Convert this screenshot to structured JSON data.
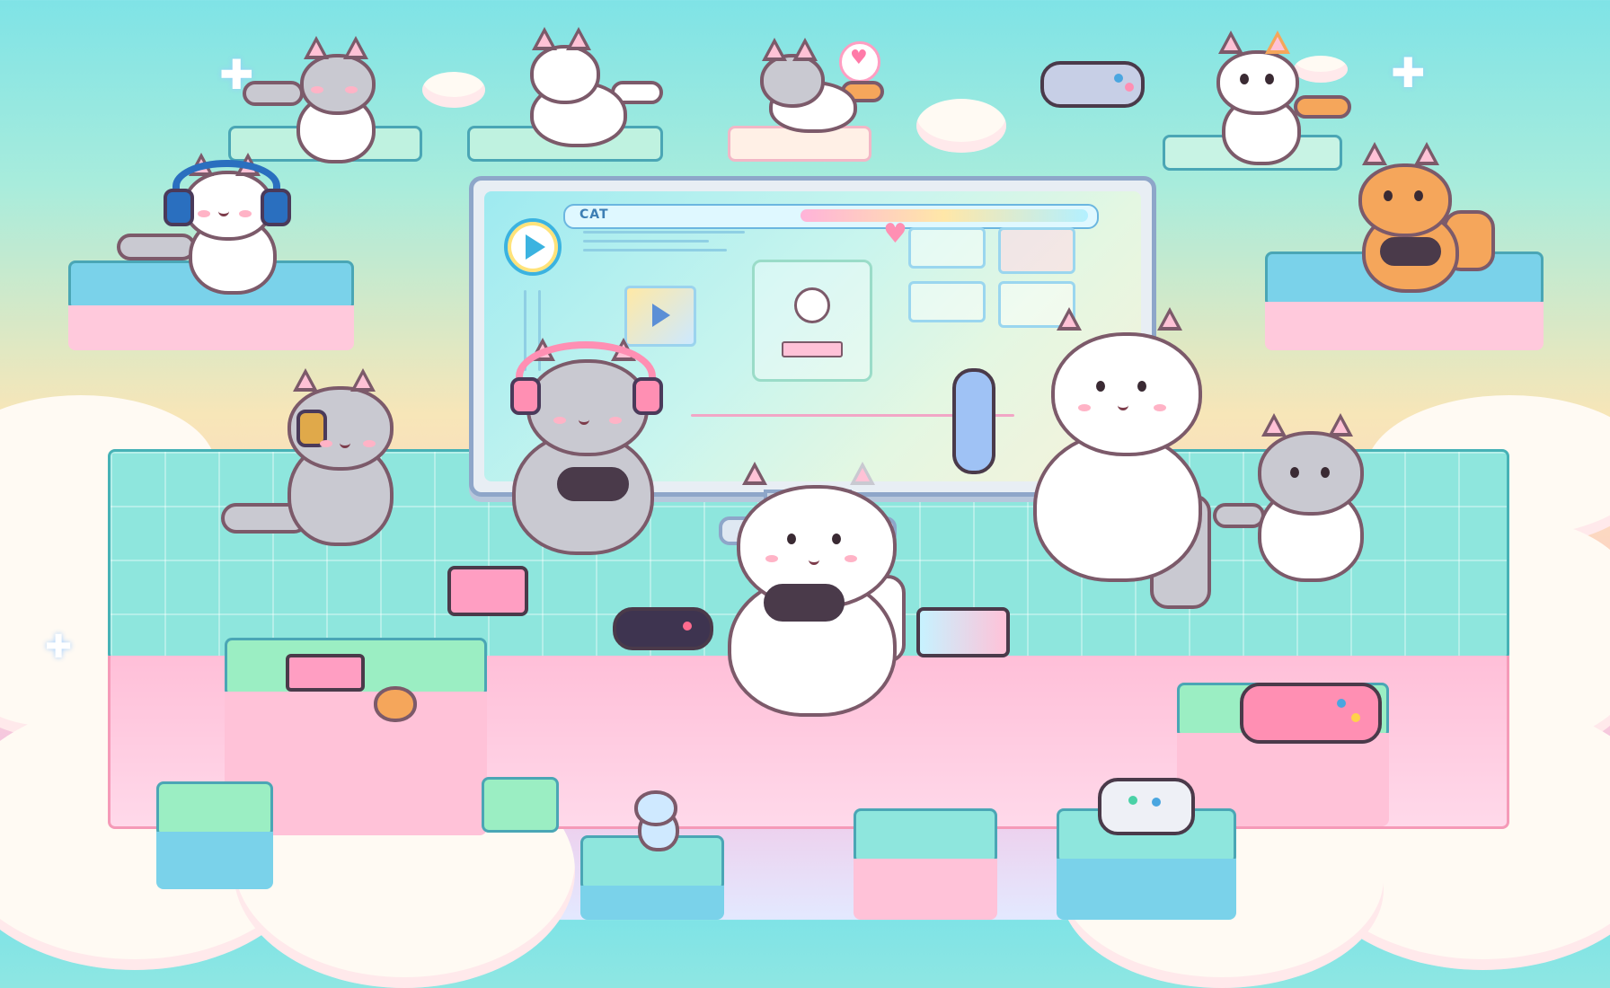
{
  "scene": {
    "title": "",
    "monitor": {
      "titlebar_label": "CAT"
    }
  },
  "colors": {
    "sky_top": "#7fe3e6",
    "sky_mid": "#f7e6b8",
    "platform_teal": "#8ee6dd",
    "platform_pink": "#ffbfd8",
    "cloud": "#fffaf3",
    "outline": "#7c5a6a"
  },
  "icons": [
    "play-icon",
    "heart-icon",
    "sparkle-icon",
    "controller-icon",
    "headphones-icon"
  ]
}
